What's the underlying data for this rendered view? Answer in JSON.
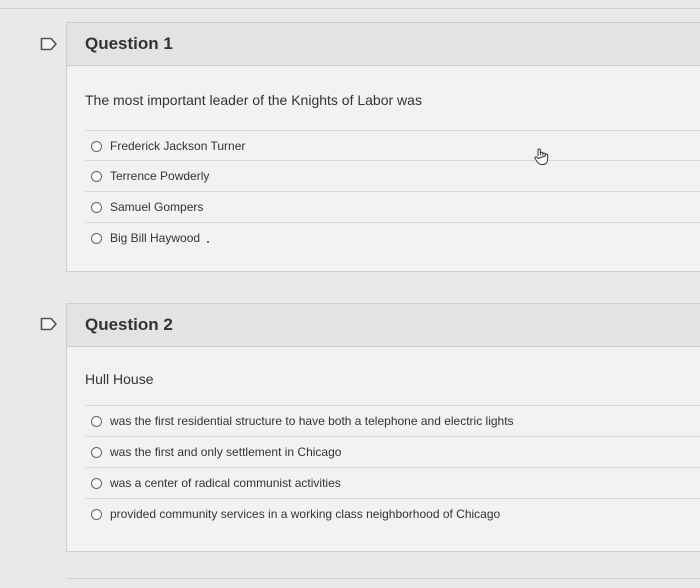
{
  "questions": [
    {
      "title": "Question 1",
      "text": "The most important leader of the Knights of Labor was",
      "options": [
        "Frederick Jackson Turner",
        "Terrence Powderly",
        "Samuel Gompers",
        "Big Bill Haywood"
      ]
    },
    {
      "title": "Question 2",
      "text": "Hull House",
      "options": [
        "was the first residential structure to have both a telephone and electric lights",
        "was the first and only settlement in Chicago",
        "was a center of radical communist activities",
        "provided community services in a working class neighborhood of Chicago"
      ]
    }
  ],
  "icons": {
    "flag": "flag-outline-icon",
    "cursor": "hand-pointer-icon"
  },
  "colors": {
    "background": "#e9e9e9",
    "header": "#e3e3e3",
    "body": "#f2f2f2"
  }
}
